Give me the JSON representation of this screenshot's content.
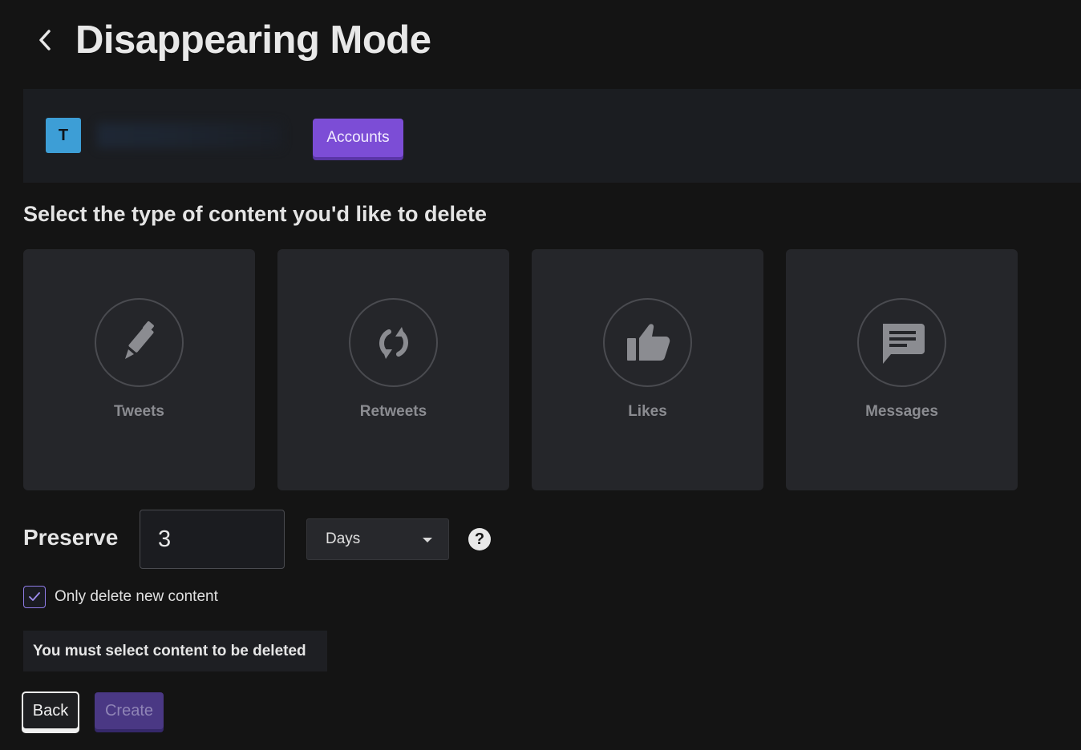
{
  "header": {
    "back_icon": "chevron-left-icon",
    "title": "Disappearing Mode"
  },
  "account": {
    "avatar_letter": "T",
    "avatar_color": "#3d9ed6",
    "accounts_button_label": "Accounts"
  },
  "content_selection": {
    "heading": "Select the type of content you'd like to delete",
    "options": [
      {
        "label": "Tweets",
        "icon": "pen-icon"
      },
      {
        "label": "Retweets",
        "icon": "retweet-icon"
      },
      {
        "label": "Likes",
        "icon": "thumbs-up-icon"
      },
      {
        "label": "Messages",
        "icon": "message-icon"
      }
    ]
  },
  "preserve": {
    "label": "Preserve",
    "value": "3",
    "unit_selected": "Days",
    "help_icon": "?"
  },
  "only_new": {
    "checked": true,
    "label": "Only delete new content"
  },
  "validation_message": "You must select content to be deleted",
  "actions": {
    "back_label": "Back",
    "create_label": "Create"
  },
  "colors": {
    "accent": "#7c4dd6",
    "background": "#141414",
    "card": "#25262a"
  }
}
